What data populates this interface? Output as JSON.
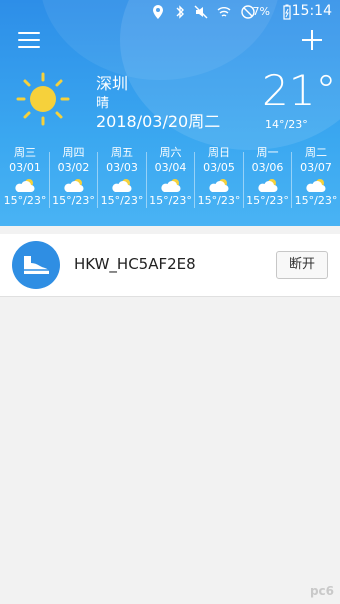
{
  "status_bar": {
    "time": "15:14",
    "battery_percent": "7%"
  },
  "weather": {
    "city": "深圳",
    "condition": "晴",
    "date": "2018/03/20周二",
    "current_temp": "21°",
    "today_range": "14°/23°",
    "forecast": [
      {
        "day": "周三",
        "date": "03/01",
        "range": "15°/23°"
      },
      {
        "day": "周四",
        "date": "03/02",
        "range": "15°/23°"
      },
      {
        "day": "周五",
        "date": "03/03",
        "range": "15°/23°"
      },
      {
        "day": "周六",
        "date": "03/04",
        "range": "15°/23°"
      },
      {
        "day": "周日",
        "date": "03/05",
        "range": "15°/23°"
      },
      {
        "day": "周一",
        "date": "03/06",
        "range": "15°/23°"
      },
      {
        "day": "周二",
        "date": "03/07",
        "range": "15°/23°"
      }
    ]
  },
  "device": {
    "name": "HKW_HC5AF2E8",
    "disconnect_label": "断开"
  },
  "watermark": "pc6",
  "colors": {
    "header_blue": "#2d8ee8",
    "sun": "#f6d13b",
    "avatar_blue": "#2f8ee3"
  }
}
